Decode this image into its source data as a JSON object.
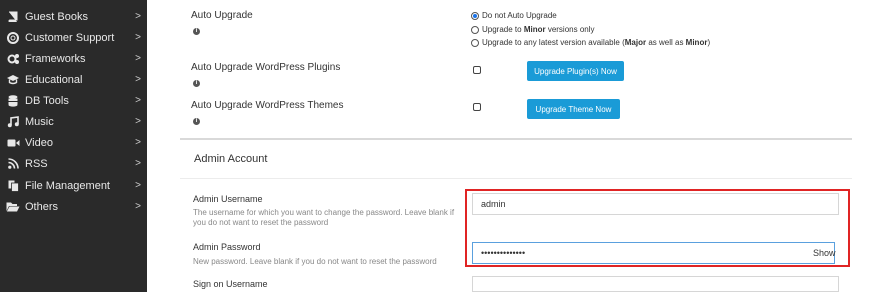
{
  "sidebar": {
    "items": [
      {
        "label": "Guest Books",
        "icon": "book-icon"
      },
      {
        "label": "Customer Support",
        "icon": "lifebuoy-icon"
      },
      {
        "label": "Frameworks",
        "icon": "cogs-icon"
      },
      {
        "label": "Educational",
        "icon": "graduation-cap-icon"
      },
      {
        "label": "DB Tools",
        "icon": "database-icon"
      },
      {
        "label": "Music",
        "icon": "music-icon"
      },
      {
        "label": "Video",
        "icon": "video-camera-icon"
      },
      {
        "label": "RSS",
        "icon": "rss-icon"
      },
      {
        "label": "File Management",
        "icon": "file-icon"
      },
      {
        "label": "Others",
        "icon": "folder-open-icon"
      }
    ],
    "chevron": ">"
  },
  "auto_upgrade": {
    "label": "Auto Upgrade",
    "options": [
      {
        "pre": "Do not Auto Upgrade",
        "bold": "",
        "post": "",
        "bold2": "",
        "post2": "",
        "selected": true
      },
      {
        "pre": "Upgrade to ",
        "bold": "Minor",
        "post": " versions only",
        "bold2": "",
        "post2": "",
        "selected": false
      },
      {
        "pre": "Upgrade to any latest version available (",
        "bold": "Major",
        "post": " as well as ",
        "bold2": "Minor",
        "post2": ")",
        "selected": false
      }
    ]
  },
  "plugins": {
    "label": "Auto Upgrade WordPress Plugins",
    "button": "Upgrade Plugin(s) Now",
    "checked": false
  },
  "themes": {
    "label": "Auto Upgrade WordPress Themes",
    "button": "Upgrade Theme Now",
    "checked": false
  },
  "admin": {
    "section_title": "Admin Account",
    "username_label": "Admin Username",
    "username_help": "The username for which you want to change the password. Leave blank if you do not want to reset the password",
    "username_value": "admin",
    "password_label": "Admin Password",
    "password_help": "New password. Leave blank if you do not want to reset the password",
    "password_value": "••••••••••••••",
    "show_label": "Show",
    "sign_on_label": "Sign on Username"
  },
  "colors": {
    "sidebar_bg": "#2a2a2a",
    "button_bg": "#1a9bd7",
    "highlight": "#e02424"
  }
}
